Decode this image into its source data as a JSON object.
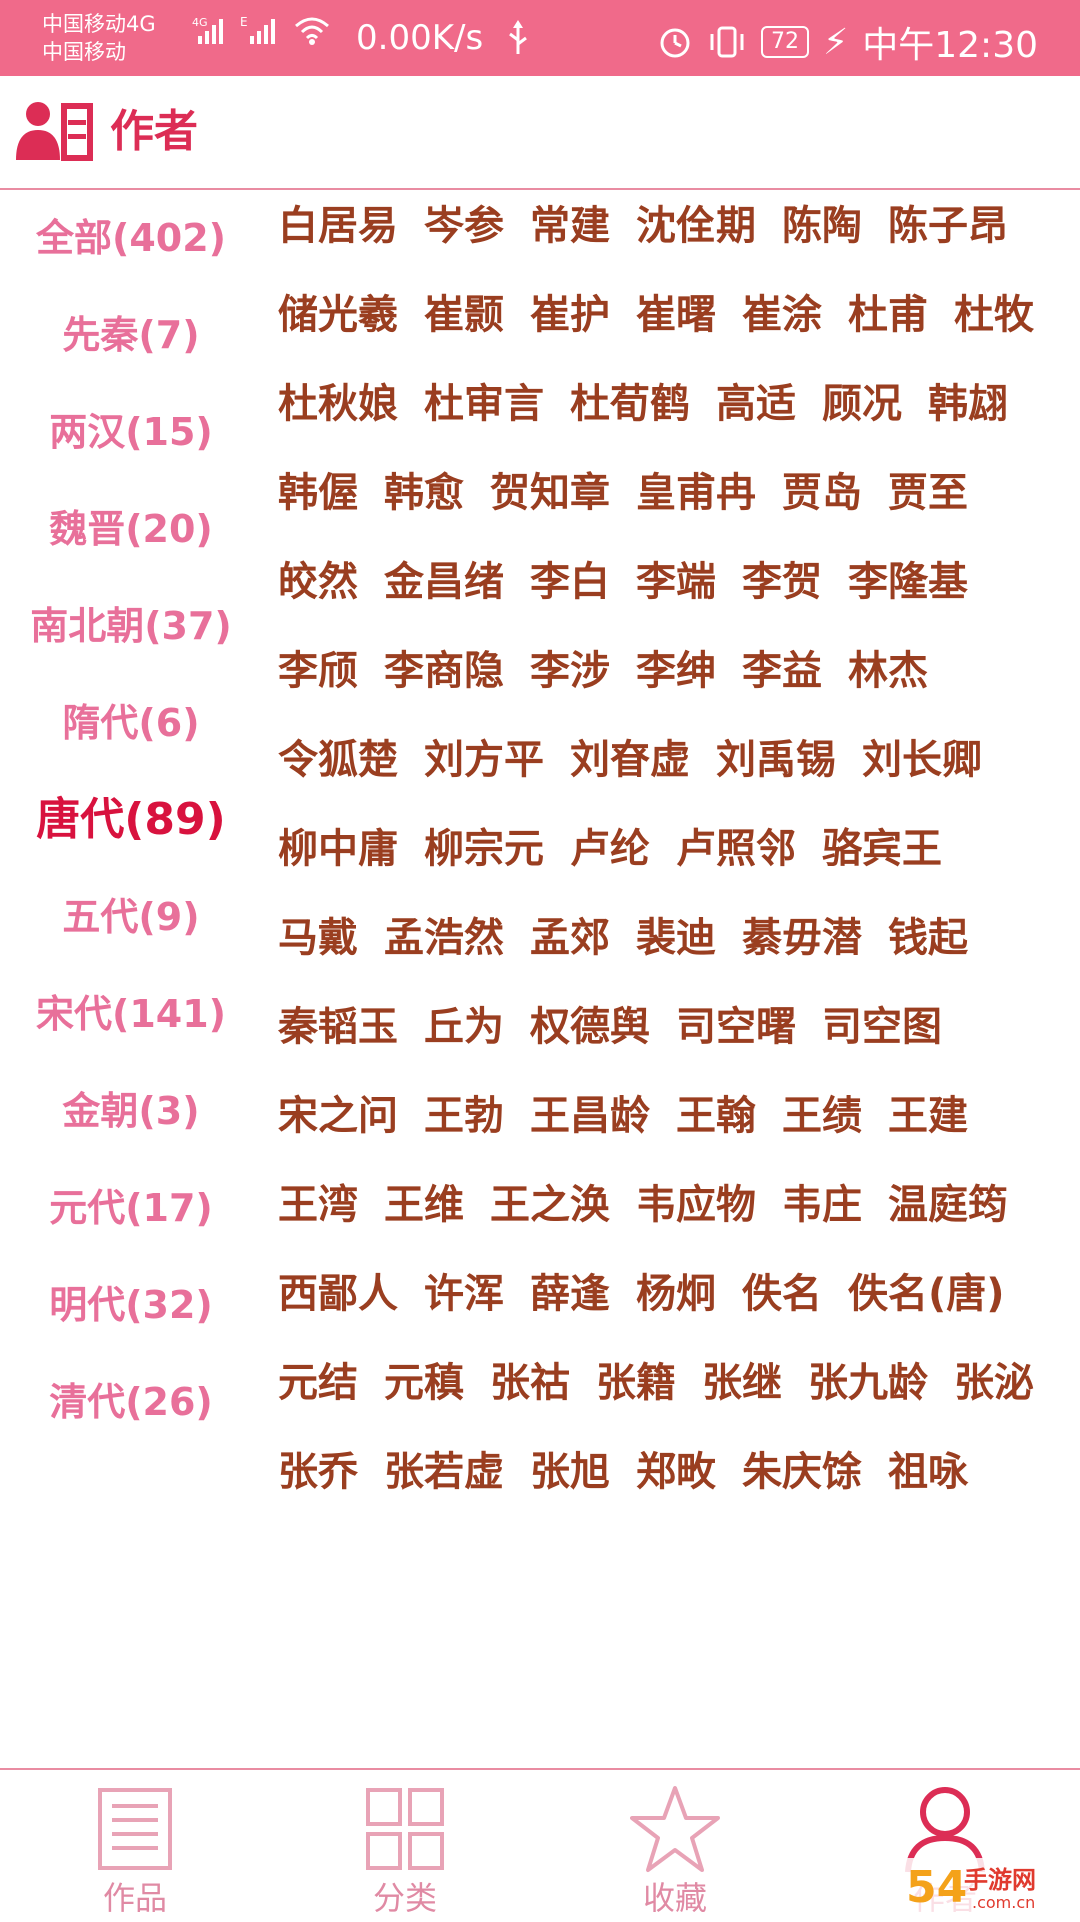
{
  "status_bar": {
    "carrier_top": "中国移动4G",
    "carrier_bottom": "中国移动",
    "speed": "0.00K/s",
    "battery": "72",
    "time": "中午12:30"
  },
  "header": {
    "title": "作者",
    "icon": "author-list-icon"
  },
  "dynasties": [
    {
      "label": "全部(402)",
      "active": false
    },
    {
      "label": "先秦(7)",
      "active": false
    },
    {
      "label": "两汉(15)",
      "active": false
    },
    {
      "label": "魏晋(20)",
      "active": false
    },
    {
      "label": "南北朝(37)",
      "active": false
    },
    {
      "label": "隋代(6)",
      "active": false
    },
    {
      "label": "唐代(89)",
      "active": true
    },
    {
      "label": "五代(9)",
      "active": false
    },
    {
      "label": "宋代(141)",
      "active": false
    },
    {
      "label": "金朝(3)",
      "active": false
    },
    {
      "label": "元代(17)",
      "active": false
    },
    {
      "label": "明代(32)",
      "active": false
    },
    {
      "label": "清代(26)",
      "active": false
    }
  ],
  "authors": [
    [
      "白居易",
      "岑参",
      "常建",
      "沈佺期",
      "陈陶",
      "陈子昂"
    ],
    [
      "储光羲",
      "崔颢",
      "崔护",
      "崔曙",
      "崔涂",
      "杜甫",
      "杜牧"
    ],
    [
      "杜秋娘",
      "杜审言",
      "杜荀鹤",
      "高适",
      "顾况",
      "韩翃"
    ],
    [
      "韩偓",
      "韩愈",
      "贺知章",
      "皇甫冉",
      "贾岛",
      "贾至"
    ],
    [
      "皎然",
      "金昌绪",
      "李白",
      "李端",
      "李贺",
      "李隆基"
    ],
    [
      "李颀",
      "李商隐",
      "李涉",
      "李绅",
      "李益",
      "林杰"
    ],
    [
      "令狐楚",
      "刘方平",
      "刘眘虚",
      "刘禹锡",
      "刘长卿"
    ],
    [
      "柳中庸",
      "柳宗元",
      "卢纶",
      "卢照邻",
      "骆宾王"
    ],
    [
      "马戴",
      "孟浩然",
      "孟郊",
      "裴迪",
      "綦毋潜",
      "钱起"
    ],
    [
      "秦韬玉",
      "丘为",
      "权德舆",
      "司空曙",
      "司空图"
    ],
    [
      "宋之问",
      "王勃",
      "王昌龄",
      "王翰",
      "王绩",
      "王建"
    ],
    [
      "王湾",
      "王维",
      "王之涣",
      "韦应物",
      "韦庄",
      "温庭筠"
    ],
    [
      "西鄙人",
      "许浑",
      "薛逢",
      "杨炯",
      "佚名",
      "佚名(唐)"
    ],
    [
      "元结",
      "元稹",
      "张祜",
      "张籍",
      "张继",
      "张九龄",
      "张泌"
    ],
    [
      "张乔",
      "张若虚",
      "张旭",
      "郑畋",
      "朱庆馀",
      "祖咏"
    ]
  ],
  "bottom_nav": [
    {
      "label": "作品",
      "icon": "document-list-icon",
      "active": false
    },
    {
      "label": "分类",
      "icon": "grid-icon",
      "active": false
    },
    {
      "label": "收藏",
      "icon": "star-icon",
      "active": false
    },
    {
      "label": "作者",
      "icon": "person-icon",
      "active": true
    }
  ],
  "watermark": {
    "text_main": "54",
    "text_side": "手游网",
    "text_sub": ".com.cn"
  }
}
